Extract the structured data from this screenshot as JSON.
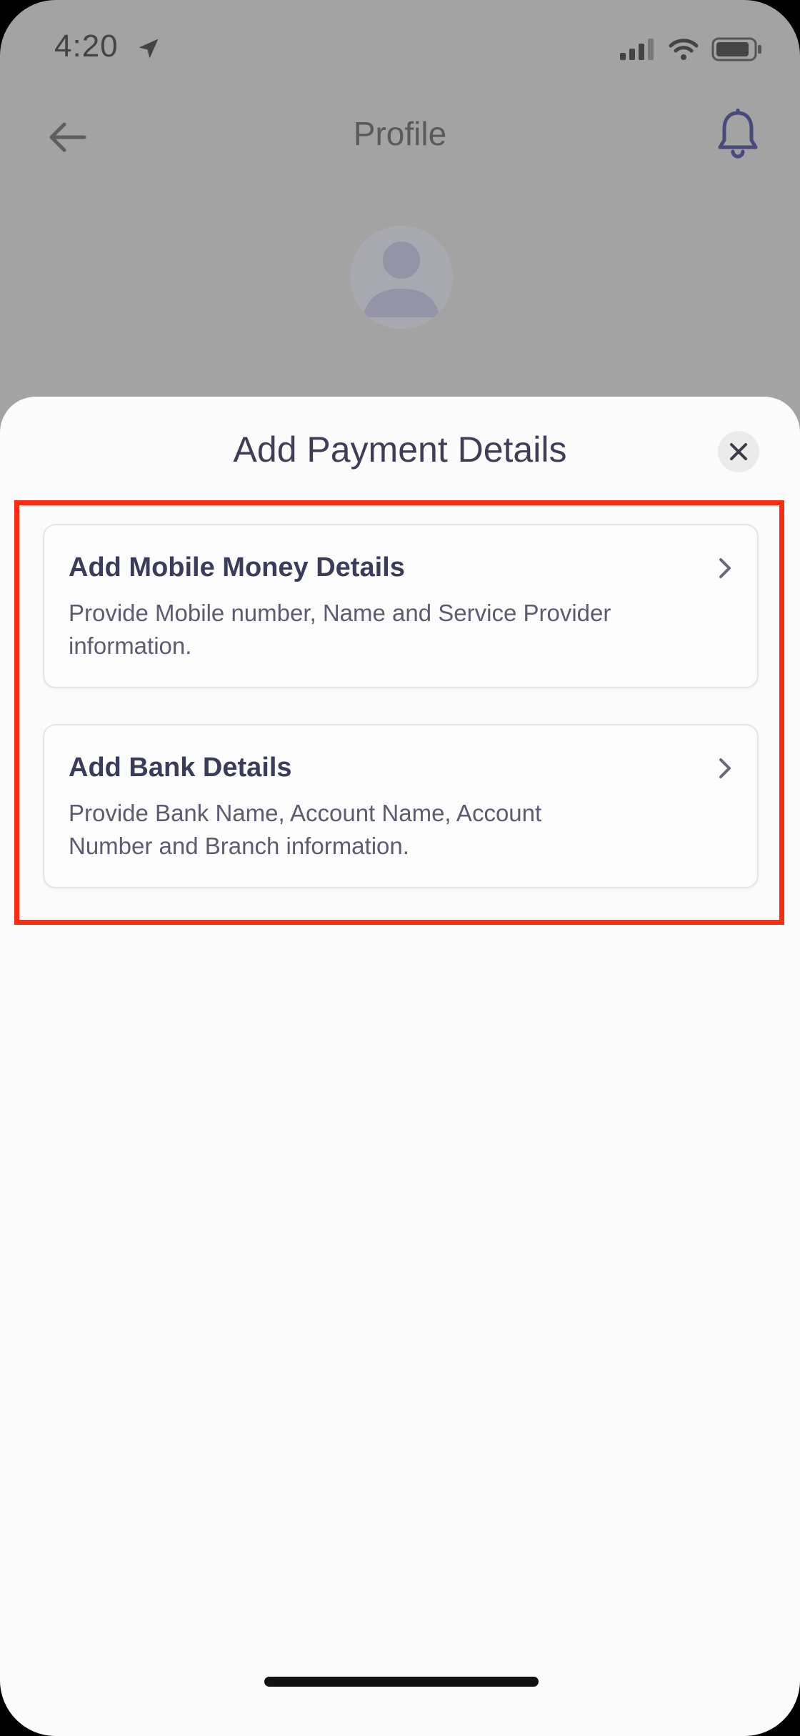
{
  "status_bar": {
    "time": "4:20"
  },
  "header": {
    "title": "Profile"
  },
  "sheet": {
    "title": "Add Payment Details",
    "options": [
      {
        "title": "Add Mobile Money Details",
        "description": "Provide Mobile number, Name and Service Provider information."
      },
      {
        "title": "Add Bank Details",
        "description": "Provide Bank Name, Account Name, Account Number and Branch information."
      }
    ]
  },
  "colors": {
    "highlight": "#ff2a12",
    "accent_icon": "#4a4a7a",
    "dim_overlay": "#a3a3a3",
    "sheet_bg": "#fbfbfb"
  },
  "icons": {
    "back": "arrow-left-icon",
    "notification": "bell-icon",
    "close": "close-icon",
    "chevron": "chevron-right-icon",
    "location": "location-arrow-icon",
    "signal": "signal-icon",
    "wifi": "wifi-icon",
    "battery": "battery-icon",
    "avatar": "avatar-icon"
  }
}
